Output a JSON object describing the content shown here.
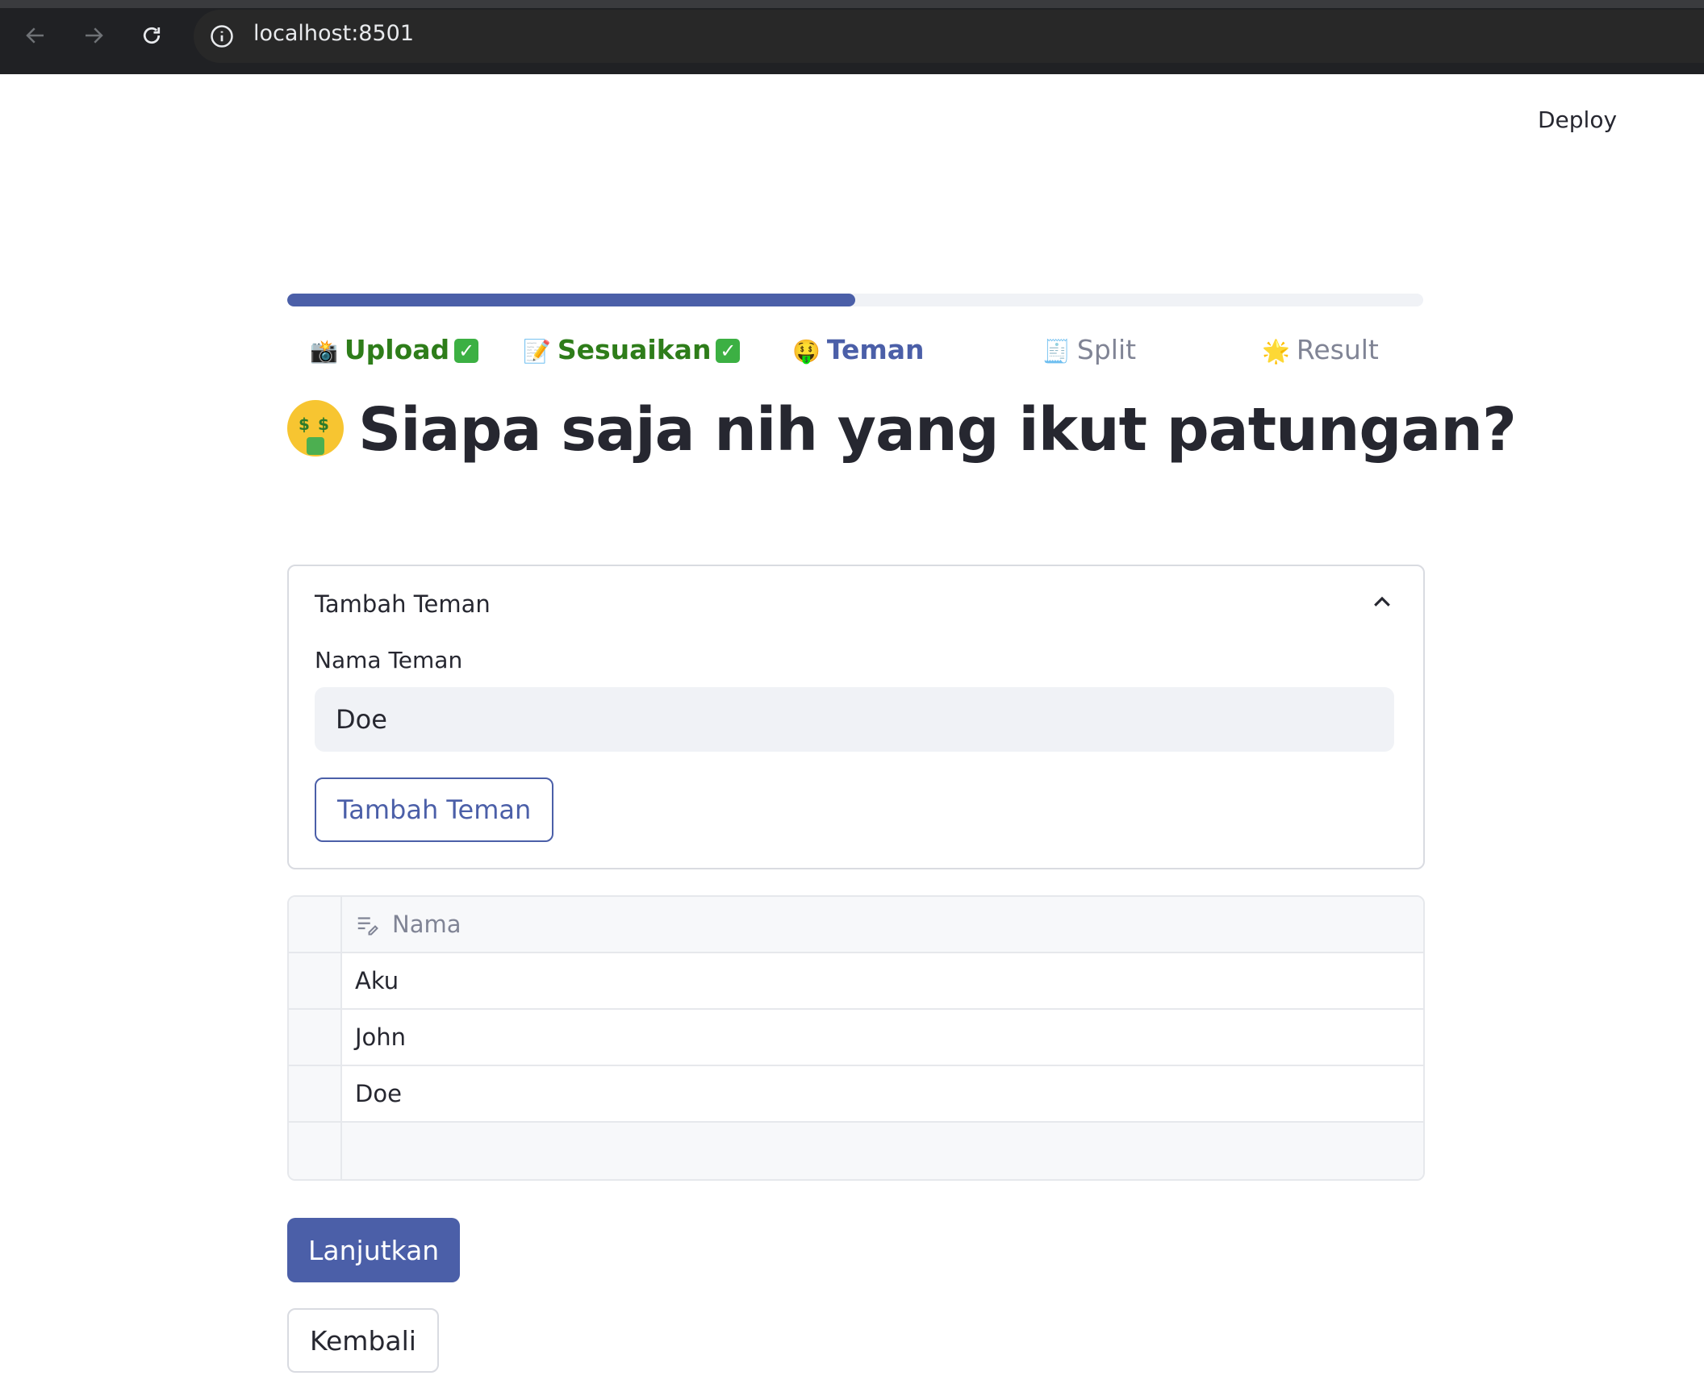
{
  "browser": {
    "url": "localhost:8501",
    "back_icon": "arrow-left-icon",
    "forward_icon": "arrow-right-icon",
    "reload_icon": "reload-icon",
    "info_icon": "info-icon"
  },
  "header": {
    "deploy_label": "Deploy"
  },
  "progress": {
    "fraction": 0.5,
    "color": "#4b5fa8"
  },
  "steps": [
    {
      "emoji": "📸",
      "label": "Upload",
      "state": "done",
      "check": "✓"
    },
    {
      "emoji": "📝",
      "label": "Sesuaikan",
      "state": "done",
      "check": "✓"
    },
    {
      "emoji": "🤑",
      "label": "Teman",
      "state": "active"
    },
    {
      "emoji": "🧾",
      "label": "Split",
      "state": "todo"
    },
    {
      "emoji": "🌟",
      "label": "Result",
      "state": "todo"
    }
  ],
  "page": {
    "title": "Siapa saja nih yang ikut patungan?"
  },
  "expander": {
    "title": "Tambah Teman",
    "field_label": "Nama Teman",
    "field_value": "Doe",
    "button_label": "Tambah Teman"
  },
  "table": {
    "column": "Nama",
    "rows": [
      "Aku",
      "John",
      "Doe"
    ]
  },
  "actions": {
    "continue_label": "Lanjutkan",
    "back_label": "Kembali"
  },
  "colors": {
    "accent": "#4b5fa8",
    "done": "#2e7d1a",
    "muted": "#808495"
  }
}
